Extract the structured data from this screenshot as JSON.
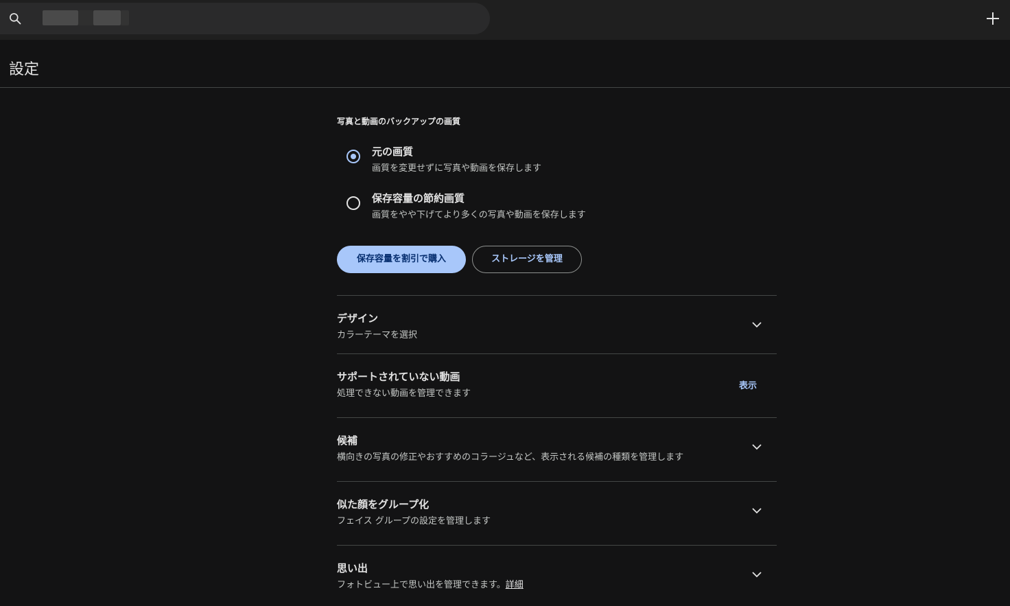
{
  "search": {
    "placeholder": ""
  },
  "page": {
    "title": "設定"
  },
  "backup": {
    "heading": "写真と動画のバックアップの画質",
    "options": [
      {
        "title": "元の画質",
        "description": "画質を変更せずに写真や動画を保存します",
        "selected": true
      },
      {
        "title": "保存容量の節約画質",
        "description": "画質をやや下げてより多くの写真や動画を保存します",
        "selected": false
      }
    ],
    "buy_button": "保存容量を割引で購入",
    "manage_button": "ストレージを管理"
  },
  "settings": {
    "design": {
      "title": "デザイン",
      "description": "カラーテーマを選択"
    },
    "unsupported_videos": {
      "title": "サポートされていない動画",
      "description": "処理できない動画を管理できます",
      "action": "表示"
    },
    "suggestions": {
      "title": "候補",
      "description": "横向きの写真の修正やおすすめのコラージュなど、表示される候補の種類を管理します"
    },
    "face_groups": {
      "title": "似た顔をグループ化",
      "description": "フェイス グループの設定を管理します"
    },
    "memories": {
      "title": "思い出",
      "description": "フォトビュー上で思い出を管理できます。",
      "link": "詳細"
    }
  },
  "colors": {
    "background": "#131314",
    "topbar": "#1f1f1f",
    "accent": "#a8c7fa",
    "divider": "#444746"
  },
  "icons": {
    "search": "search-icon",
    "add": "plus-icon",
    "expand": "chevron-down-icon"
  }
}
